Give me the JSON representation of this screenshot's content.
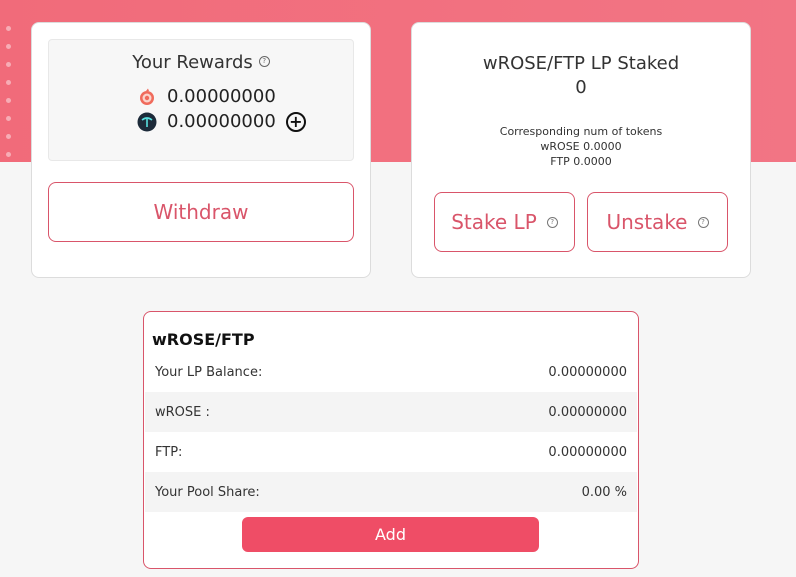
{
  "rewards": {
    "title": "Your Rewards",
    "help_glyph": "?",
    "items": [
      {
        "icon": "rose-token-icon",
        "value": "0.00000000"
      },
      {
        "icon": "ftp-token-icon",
        "value": "0.00000000"
      }
    ],
    "add_glyph": "+",
    "withdraw_label": "Withdraw"
  },
  "staked": {
    "title": "wROSE/FTP LP Staked",
    "value": "0",
    "tokens_heading": "Corresponding num of tokens",
    "wrose_line": "wROSE 0.0000",
    "ftp_line": "FTP 0.0000",
    "stake_label": "Stake LP",
    "unstake_label": "Unstake",
    "help_glyph": "?"
  },
  "pool": {
    "title": "wROSE/FTP",
    "rows": [
      {
        "label": "Your LP Balance:",
        "value": "0.00000000"
      },
      {
        "label": "wROSE :",
        "value": "0.00000000"
      },
      {
        "label": "FTP:",
        "value": "0.00000000"
      },
      {
        "label": "Your Pool Share:",
        "value": "0.00 %"
      }
    ],
    "add_label": "Add"
  },
  "colors": {
    "hero": "#f16b7a",
    "accent": "#d9556a",
    "primary_button": "#ef4d66"
  }
}
